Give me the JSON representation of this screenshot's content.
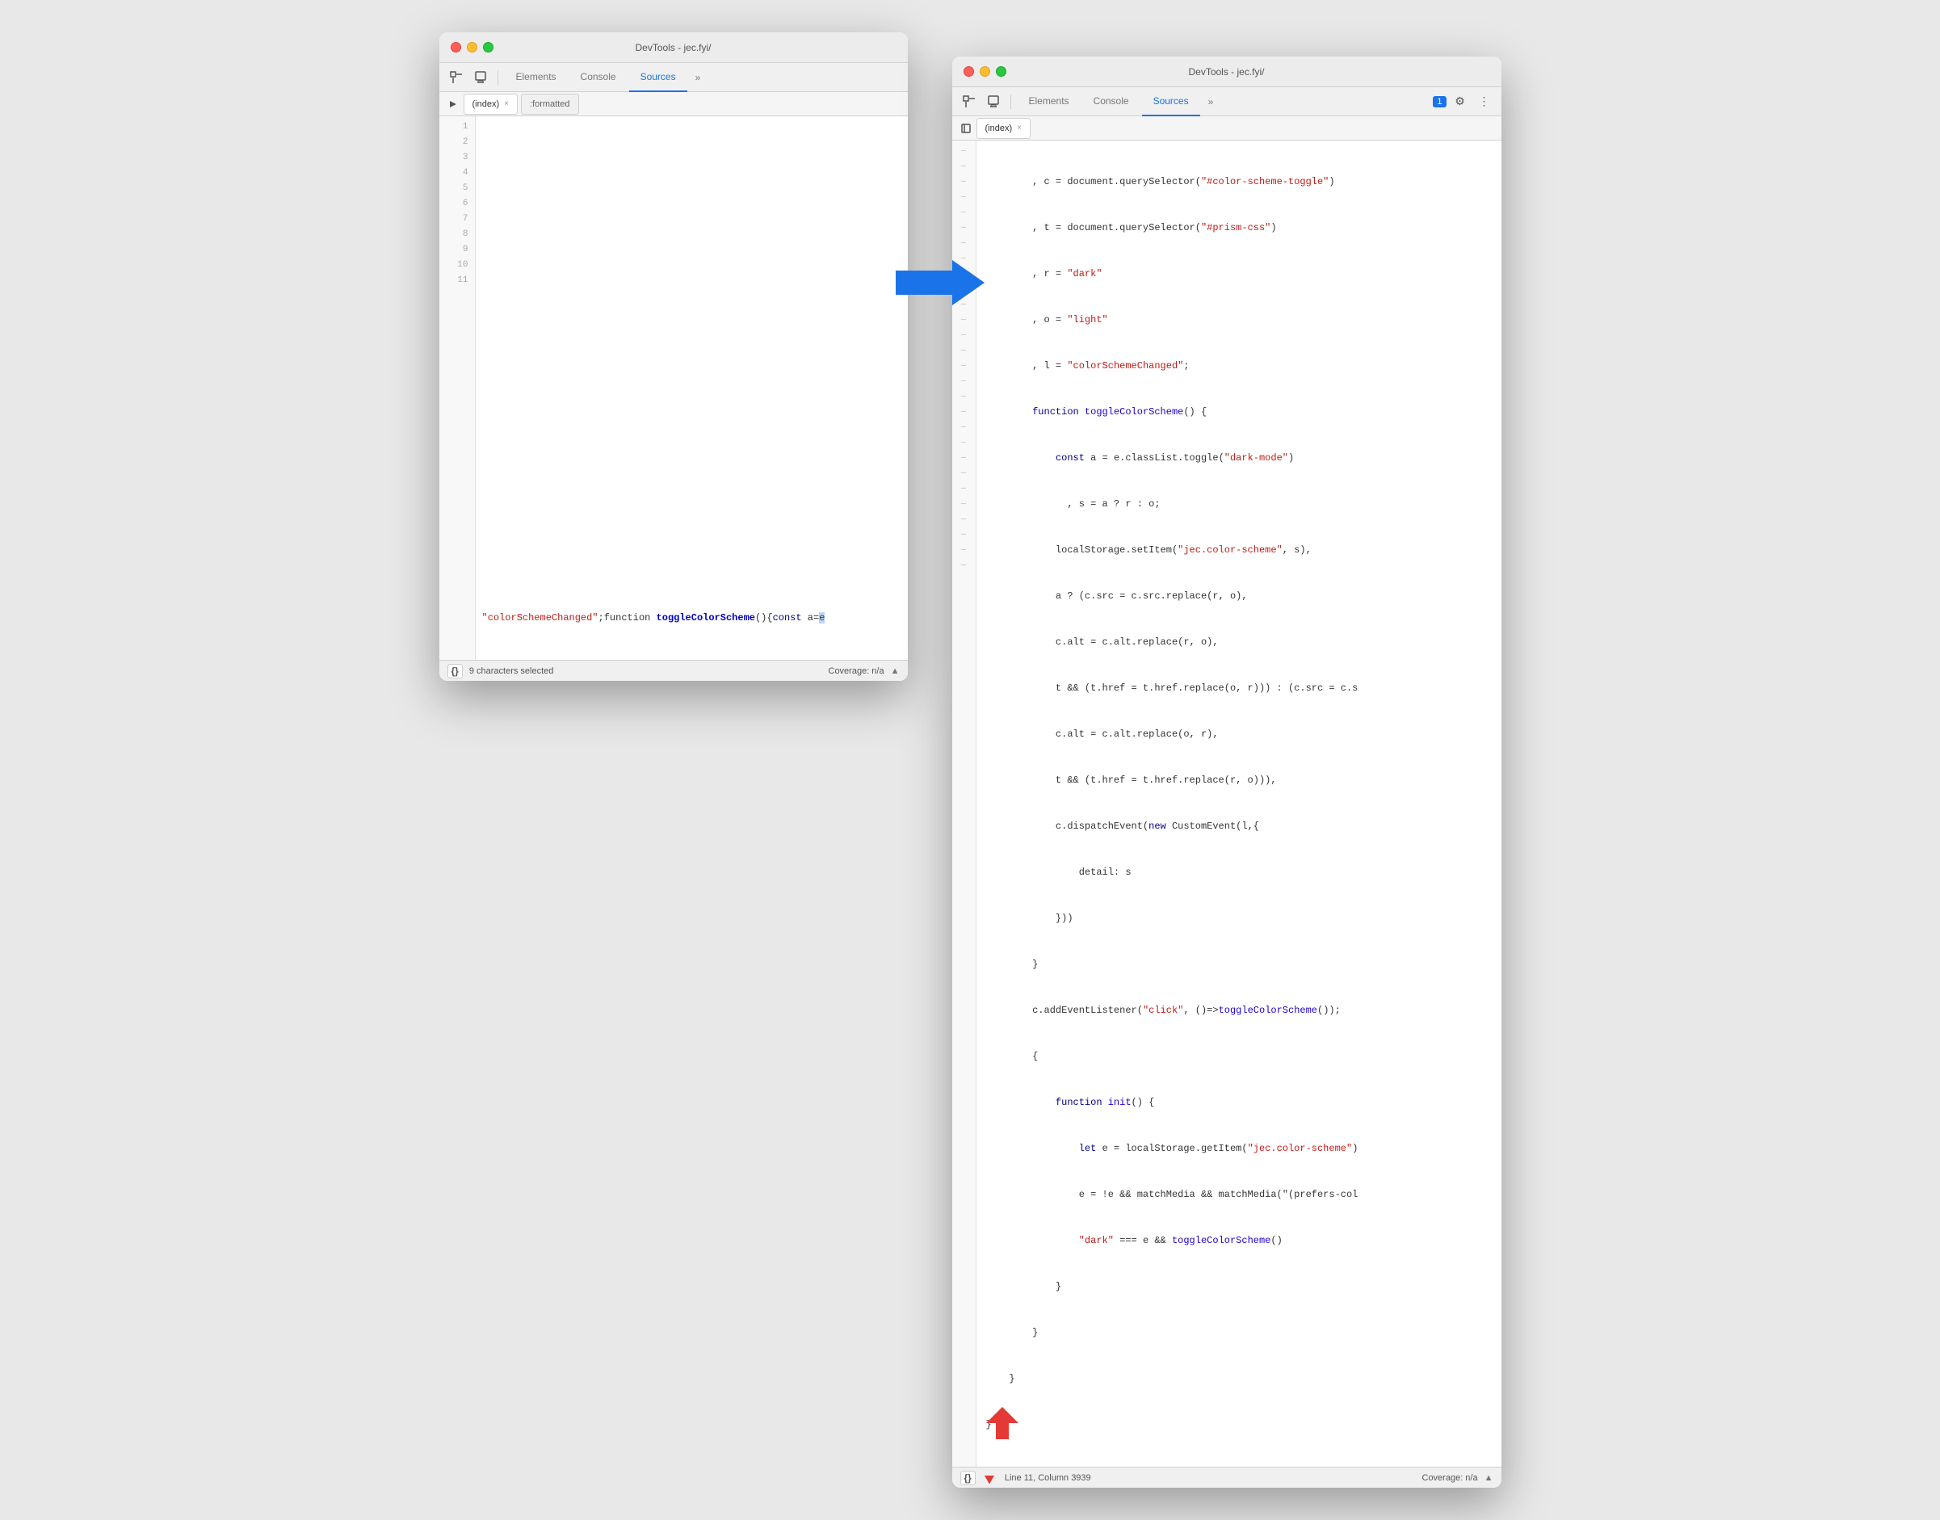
{
  "left_window": {
    "title": "DevTools - jec.fyi/",
    "tabs": [
      "Elements",
      "Console",
      "Sources"
    ],
    "active_tab": "Sources",
    "source_tabs": [
      "(index)",
      ":formatted"
    ],
    "active_source_tab": "(index)",
    "line_numbers": [
      "1",
      "2",
      "3",
      "4",
      "5",
      "6",
      "7",
      "8",
      "9",
      "10",
      "11"
    ],
    "line11_code": "ed\";function toggleColorScheme(){const a=e",
    "status": {
      "pretty_print": "{}",
      "text": "9 characters selected",
      "coverage": "Coverage: n/a"
    }
  },
  "right_window": {
    "title": "DevTools - jec.fyi/",
    "tabs": [
      "Elements",
      "Console",
      "Sources"
    ],
    "active_tab": "Sources",
    "source_tabs": [
      "(index)"
    ],
    "badge": "1",
    "code_lines": [
      "        , c = document.querySelector(\"#color-scheme-toggle\")",
      "        , t = document.querySelector(\"#prism-css\")",
      "        , r = \"dark\"",
      "        , o = \"light\"",
      "        , l = \"colorSchemeChanged\";",
      "        function toggleColorScheme() {",
      "            const a = e.classList.toggle(\"dark-mode\")",
      "              , s = a ? r : o;",
      "            localStorage.setItem(\"jec.color-scheme\", s),",
      "            a ? (c.src = c.src.replace(r, o),",
      "            c.alt = c.alt.replace(r, o),",
      "            t && (t.href = t.href.replace(o, r))) : (c.src = c.s",
      "            c.alt = c.alt.replace(o, r),",
      "            t && (t.href = t.href.replace(r, o))),",
      "            c.dispatchEvent(new CustomEvent(l,{",
      "                detail: s",
      "            }))",
      "        }",
      "        c.addEventListener(\"click\", ()=>toggleColorScheme());",
      "        {",
      "            function init() {",
      "                let e = localStorage.getItem(\"jec.color-scheme\")",
      "                e = !e && matchMedia && matchMedia(\"(prefers-col",
      "                \"dark\" === e && toggleColorScheme()",
      "            }",
      "        }",
      "    }",
      "}"
    ],
    "status": {
      "pretty_print": "{}",
      "cursor_pos": "Line 11, Column 3939",
      "coverage": "Coverage: n/a"
    }
  },
  "icons": {
    "inspector": "⬚",
    "device": "⬜",
    "more": "»",
    "panel_toggle": "▶",
    "close": "×",
    "settings": "⚙",
    "more_vert": "⋮",
    "comment": "💬",
    "scroll_up": "▲"
  }
}
